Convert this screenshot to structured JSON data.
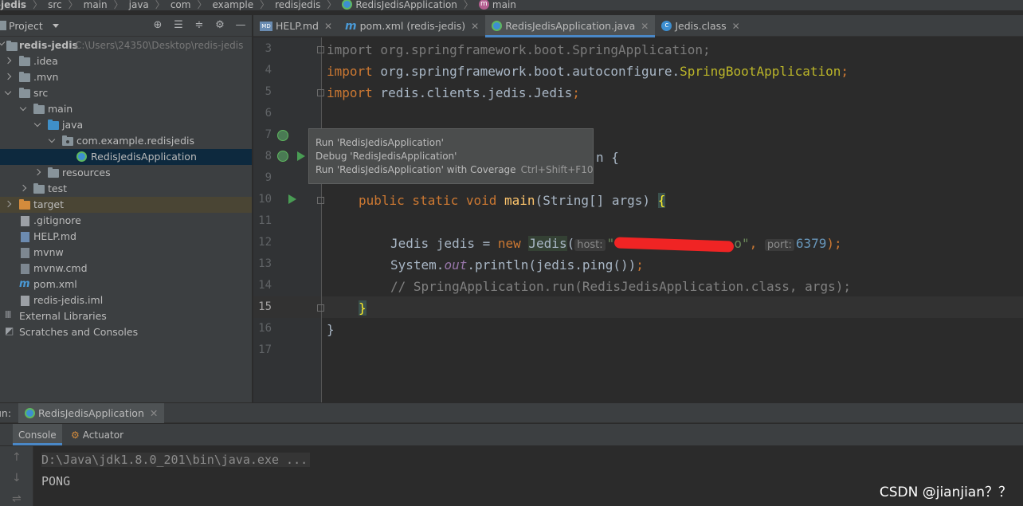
{
  "breadcrumb": {
    "items": [
      "-jedis",
      "src",
      "main",
      "java",
      "com",
      "example",
      "redisjedis",
      "RedisJedisApplication",
      "main"
    ]
  },
  "project_panel": {
    "title": "Project",
    "tree": [
      {
        "label": "redis-jedis",
        "path": "C:\\Users\\24350\\Desktop\\redis-jedis"
      },
      {
        "label": ".idea"
      },
      {
        "label": ".mvn"
      },
      {
        "label": "src"
      },
      {
        "label": "main"
      },
      {
        "label": "java"
      },
      {
        "label": "com.example.redisjedis"
      },
      {
        "label": "RedisJedisApplication"
      },
      {
        "label": "resources"
      },
      {
        "label": "test"
      },
      {
        "label": "target"
      },
      {
        "label": ".gitignore"
      },
      {
        "label": "HELP.md"
      },
      {
        "label": "mvnw"
      },
      {
        "label": "mvnw.cmd"
      },
      {
        "label": "pom.xml"
      },
      {
        "label": "redis-jedis.iml"
      },
      {
        "label": "External Libraries"
      },
      {
        "label": "Scratches and Consoles"
      }
    ]
  },
  "tabs": [
    {
      "label": "HELP.md"
    },
    {
      "label": "pom.xml (redis-jedis)"
    },
    {
      "label": "RedisJedisApplication.java"
    },
    {
      "label": "Jedis.class"
    }
  ],
  "editor": {
    "line_numbers": [
      "3",
      "4",
      "5",
      "6",
      "7",
      "8",
      "9",
      "10",
      "11",
      "12",
      "13",
      "14",
      "15",
      "16",
      "17"
    ],
    "current_line": "15",
    "code": {
      "l3_kw": "import",
      "l3_rest": " org.springframework.boot.SpringApplication;",
      "l4_kw": "import",
      "l4_pkg": " org.springframework.boot.autoconfigure.",
      "l4_ann": "SpringBootApplication",
      "l4_end": ";",
      "l5_kw": "import",
      "l5_rest": " redis.clients.jedis.Jedis",
      "l5_end": ";",
      "l8_rest": "n {",
      "l10_kw": "public static void",
      "l10_fn": "main",
      "l10_rest": "(String[] args) ",
      "l10_brace": "{",
      "l12_a": "Jedis jedis = ",
      "l12_new": "new",
      "l12_cls": "Jedis",
      "l12_paren": "(",
      "l12_hint_host": "host:",
      "l12_q1": "\"",
      "l12_q2": "o\"",
      "l12_comma": ", ",
      "l12_hint_port": "port:",
      "l12_port": "6379",
      "l12_end": ");",
      "l13_a": "System.",
      "l13_out": "out",
      "l13_b": ".println(jedis.ping())",
      "l13_end": ";",
      "l14": "// SpringApplication.run(RedisJedisApplication.class, args);",
      "l15": "}",
      "l16": "}"
    }
  },
  "tooltip": {
    "run": "Run 'RedisJedisApplication'",
    "debug": "Debug 'RedisJedisApplication'",
    "coverage": "Run 'RedisJedisApplication' with Coverage",
    "coverage_shortcut": "Ctrl+Shift+F10"
  },
  "run_window": {
    "label": "un:",
    "config_tab": "RedisJedisApplication",
    "console_tab": "Console",
    "actuator_tab": "Actuator",
    "output": [
      "D:\\Java\\jdk1.8.0_201\\bin\\java.exe ...",
      "PONG"
    ]
  },
  "watermark": "CSDN @jianjian？？"
}
